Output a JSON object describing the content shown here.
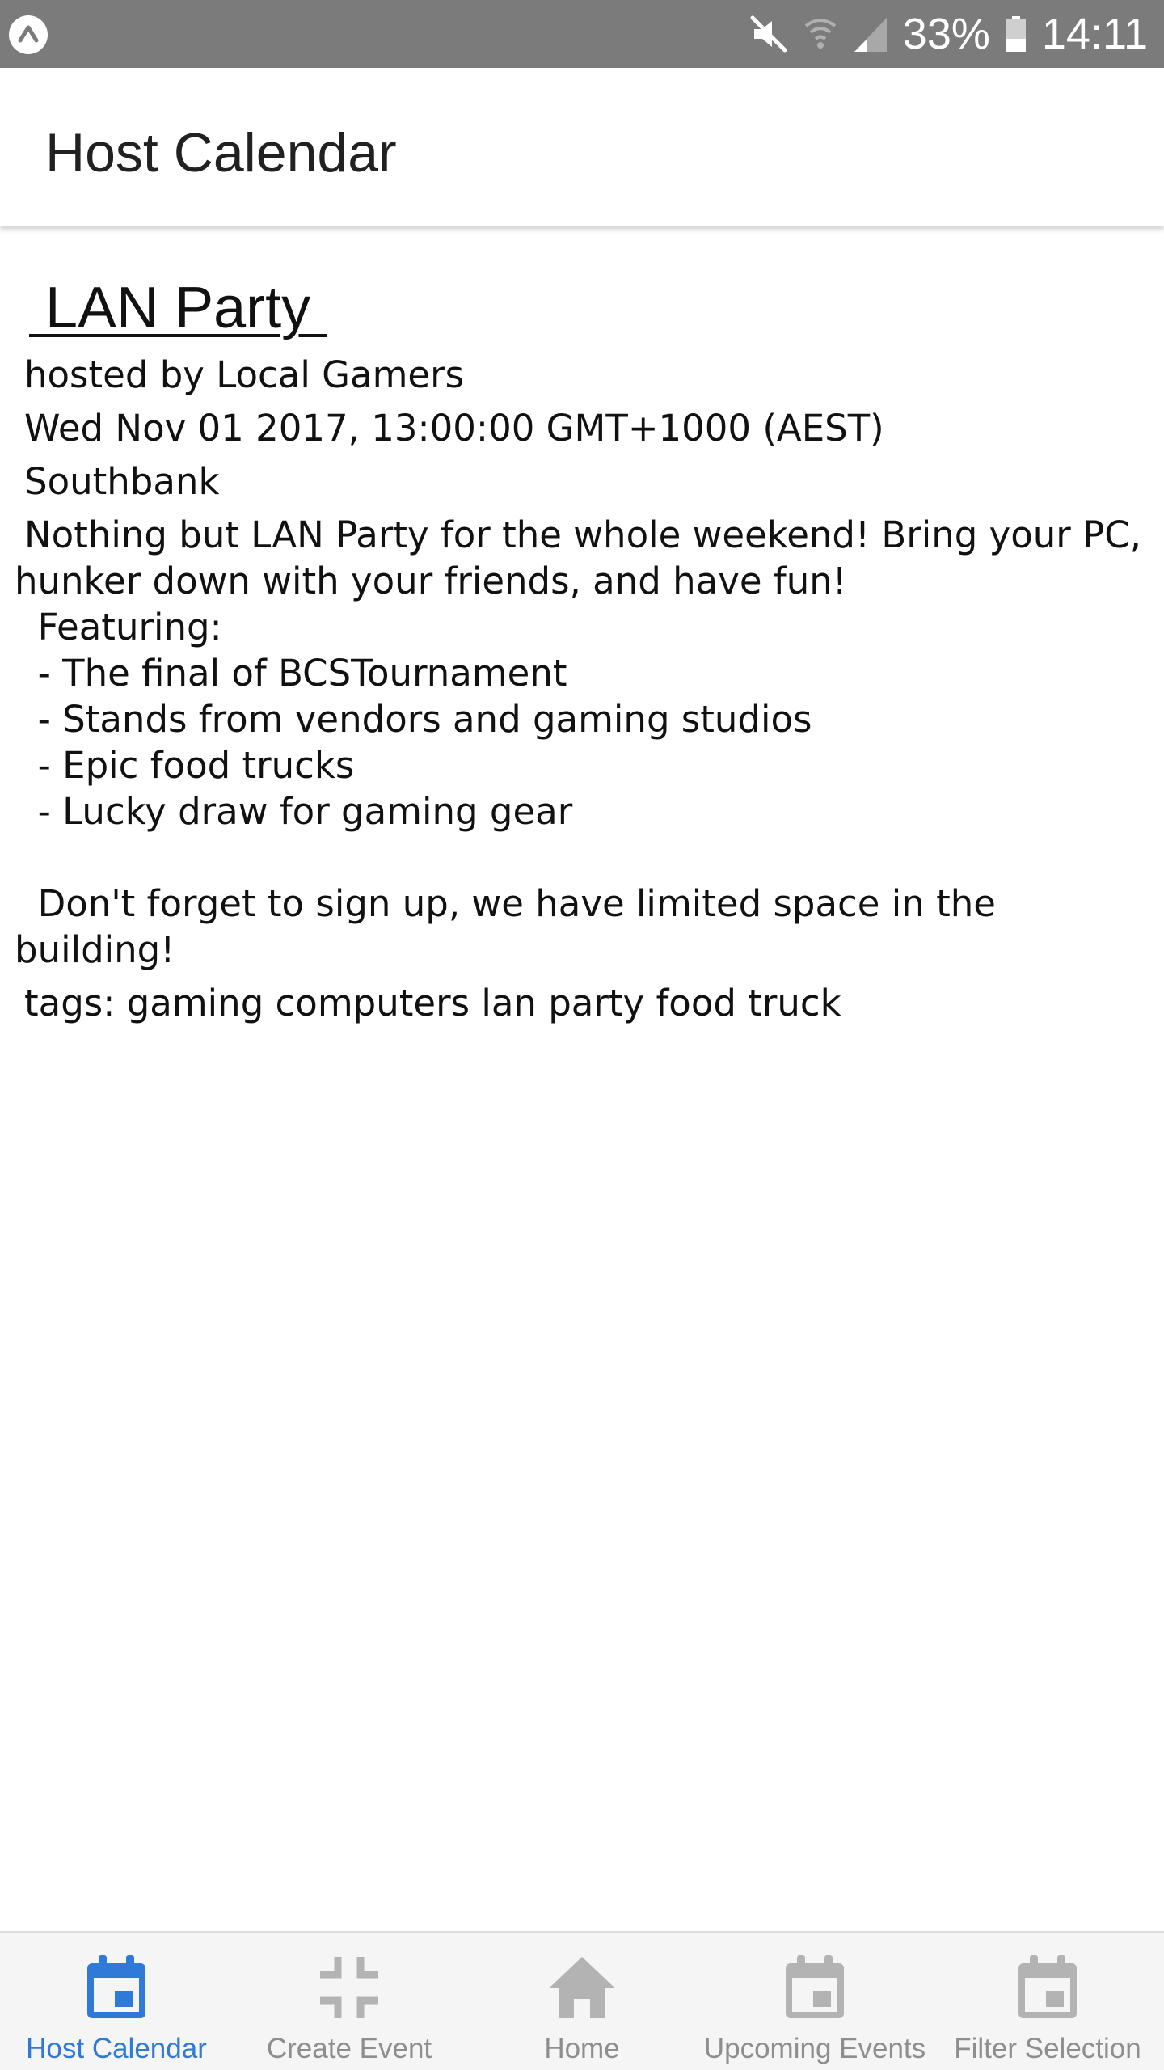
{
  "status_bar": {
    "battery": "33%",
    "time": "14:11",
    "icons": [
      "expand-icon",
      "mute-icon",
      "wifi-icon",
      "signal-icon",
      "battery-icon"
    ]
  },
  "app_bar": {
    "title": "Host Calendar"
  },
  "event": {
    "title": " LAN Party ",
    "host": "hosted by Local Gamers",
    "datetime": "Wed Nov 01 2017, 13:00:00 GMT+1000 (AEST)",
    "location": "Southbank",
    "description_first": "Nothing but LAN Party for the whole weekend! Bring your PC, hunker down with your friends, and have fun!",
    "description_rest": "  Featuring:\n  - The final of BCSTournament\n  - Stands from vendors and gaming studios\n  - Epic food trucks\n  - Lucky draw for gaming gear\n\n  Don't forget to sign up, we have limited space in the building!",
    "tags": "tags: gaming computers lan party food truck"
  },
  "bottom_nav": {
    "active_color": "#2f7ad9",
    "inactive_color": "#8e8e8e",
    "items": [
      {
        "label": "Host Calendar",
        "icon": "calendar-icon",
        "active": true
      },
      {
        "label": "Create Event",
        "icon": "collapse-icon",
        "active": false
      },
      {
        "label": "Home",
        "icon": "home-icon",
        "active": false
      },
      {
        "label": "Upcoming Events",
        "icon": "calendar-icon",
        "active": false
      },
      {
        "label": "Filter Selection",
        "icon": "calendar-icon",
        "active": false
      }
    ]
  }
}
